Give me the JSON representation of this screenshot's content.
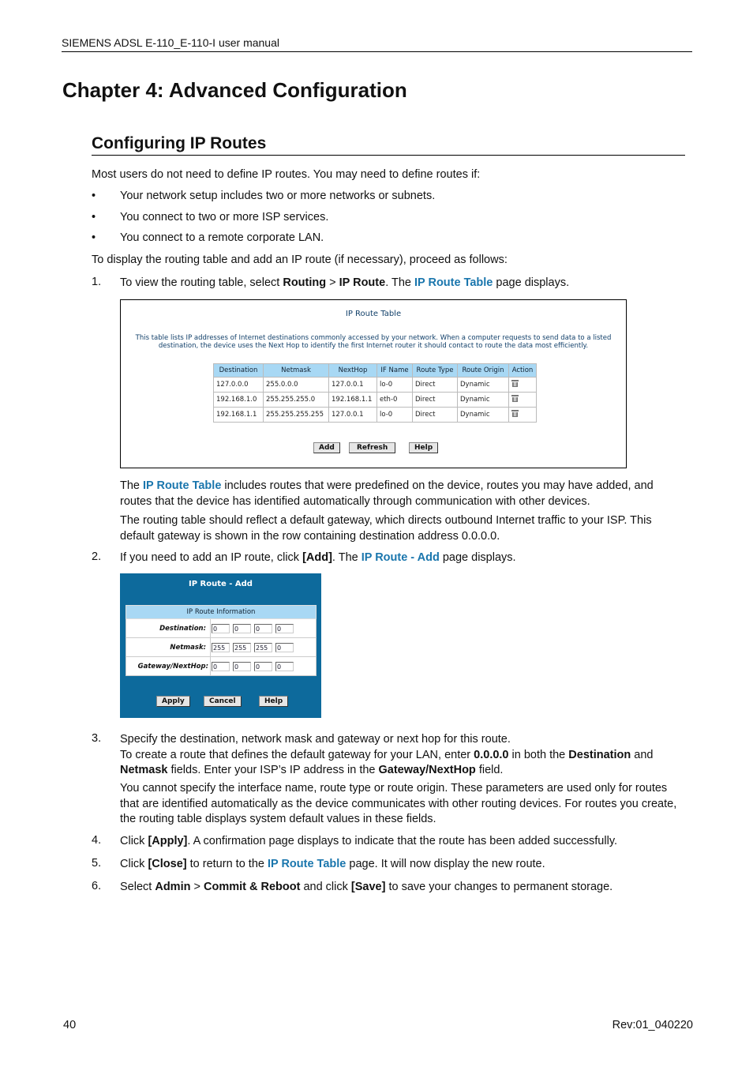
{
  "header": "SIEMENS ADSL E-110_E-110-I user manual",
  "chapter_title": "Chapter 4: Advanced Configuration",
  "section_title": "Configuring IP Routes",
  "intro": "Most users do not need to define IP routes. You may need to define routes if:",
  "bullets": [
    "Your network setup includes two or more networks or subnets.",
    "You connect to two or more ISP services.",
    "You connect to a remote corporate LAN."
  ],
  "proceed": "To display the routing table and add an IP route (if necessary), proceed as follows:",
  "steps": {
    "s1": {
      "num": "1.",
      "a": "To view the routing table, select ",
      "b1": "Routing",
      "c": " > ",
      "b2": "IP Route",
      "d": ". The ",
      "link": "IP Route Table",
      "e": " page displays."
    },
    "s1_p1": {
      "a": "The ",
      "link": "IP Route Table",
      "b": " includes routes that were predefined on the device, routes you may have added, and routes that the device has identified automatically through communication with other devices."
    },
    "s1_p2": "The routing table should reflect a default gateway, which directs outbound Internet traffic to your ISP. This default gateway is shown in the row containing destination address 0.0.0.0.",
    "s2": {
      "num": "2.",
      "a": "If you need to add an IP route, click ",
      "b1": "[Add]",
      "c": ". The ",
      "link": "IP Route - Add",
      "d": " page displays."
    },
    "s3": {
      "num": "3.",
      "line1": "Specify the destination, network mask and gateway or next hop for this route.",
      "a": "To create a route that defines the default gateway for your LAN, enter ",
      "b1": "0.0.0.0",
      "c": " in both the ",
      "b2": "Destination",
      "d": " and ",
      "b3": "Netmask",
      "e": " fields. Enter your ISP’s IP address in the ",
      "b4": "Gateway/NextHop",
      "f": " field."
    },
    "s3_p": "You cannot specify the interface name, route type or route origin. These parameters are used only for routes that are identified automatically as the device communicates with other routing devices. For routes you create, the routing table displays system default values in these fields.",
    "s4": {
      "num": "4.",
      "a": "Click ",
      "b1": "[Apply]",
      "c": ". A confirmation page displays to indicate that the route has been added successfully."
    },
    "s5": {
      "num": "5.",
      "a": "Click ",
      "b1": "[Close]",
      "c": " to return to the ",
      "link": "IP Route Table",
      "d": " page. It will now display the new route."
    },
    "s6": {
      "num": "6.",
      "a": "Select ",
      "b1": "Admin",
      "c": " > ",
      "b2": "Commit & Reboot",
      "d": " and click ",
      "b3": "[Save]",
      "e": " to save your changes to permanent storage."
    }
  },
  "route_table": {
    "title": "IP Route Table",
    "description": "This table lists IP addresses of Internet destinations commonly accessed by your network. When a computer requests to send data to a listed destination, the device uses the Next Hop to identify the first Internet router it should contact to route the data most efficiently.",
    "columns": [
      "Destination",
      "Netmask",
      "NextHop",
      "IF Name",
      "Route Type",
      "Route Origin",
      "Action"
    ],
    "rows": [
      [
        "127.0.0.0",
        "255.0.0.0",
        "127.0.0.1",
        "lo-0",
        "Direct",
        "Dynamic"
      ],
      [
        "192.168.1.0",
        "255.255.255.0",
        "192.168.1.1",
        "eth-0",
        "Direct",
        "Dynamic"
      ],
      [
        "192.168.1.1",
        "255.255.255.255",
        "127.0.0.1",
        "lo-0",
        "Direct",
        "Dynamic"
      ]
    ],
    "action_icon": "trash-icon",
    "buttons": {
      "add": "Add",
      "refresh": "Refresh",
      "help": "Help"
    }
  },
  "route_add": {
    "title": "IP Route - Add",
    "section": "IP Route Information",
    "fields": [
      {
        "label": "Destination:",
        "values": [
          "0",
          "0",
          "0",
          "0"
        ]
      },
      {
        "label": "Netmask:",
        "values": [
          "255",
          "255",
          "255",
          "0"
        ]
      },
      {
        "label": "Gateway/NextHop:",
        "values": [
          "0",
          "0",
          "0",
          "0"
        ]
      }
    ],
    "buttons": {
      "apply": "Apply",
      "cancel": "Cancel",
      "help": "Help"
    }
  },
  "footer": {
    "page": "40",
    "rev": "Rev:01_040220"
  },
  "colors": {
    "link": "#1a76ad",
    "panel": "#0d6a9c",
    "table_header": "#a8d8f4"
  }
}
